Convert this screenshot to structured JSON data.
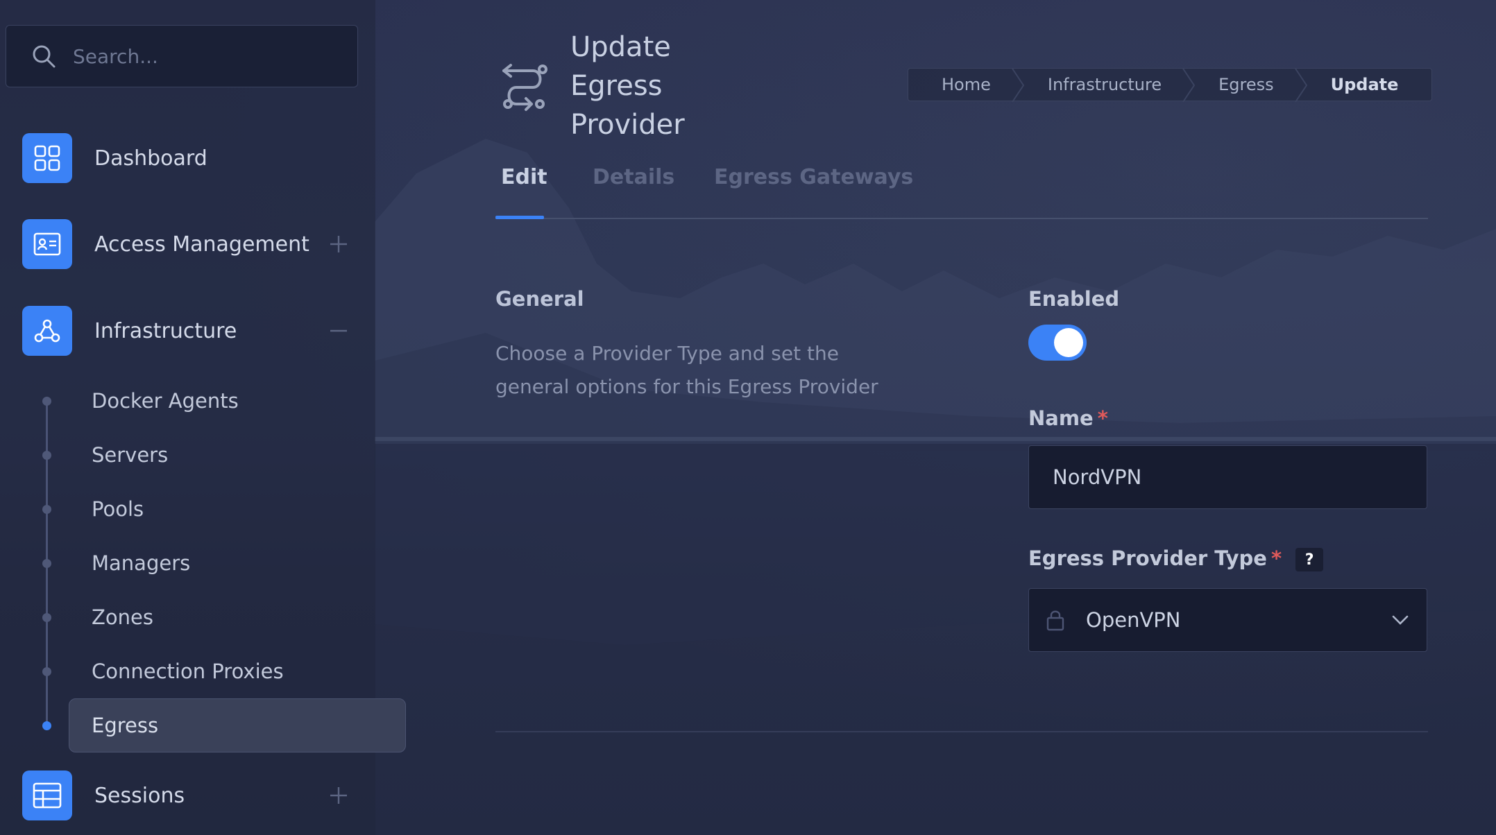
{
  "sidebar": {
    "search_placeholder": "Search...",
    "items": [
      {
        "label": "Dashboard"
      },
      {
        "label": "Access Management"
      },
      {
        "label": "Infrastructure"
      },
      {
        "label": "Sessions"
      }
    ],
    "infrastructure_children": [
      {
        "label": "Docker Agents"
      },
      {
        "label": "Servers"
      },
      {
        "label": "Pools"
      },
      {
        "label": "Managers"
      },
      {
        "label": "Zones"
      },
      {
        "label": "Connection Proxies"
      },
      {
        "label": "Egress",
        "active": true
      }
    ]
  },
  "header": {
    "title": "Update Egress Provider",
    "breadcrumb": [
      "Home",
      "Infrastructure",
      "Egress",
      "Update"
    ]
  },
  "tabs": [
    "Edit",
    "Details",
    "Egress Gateways"
  ],
  "form": {
    "general_title": "General",
    "general_description": "Choose a Provider Type and set the general options for this Egress Provider",
    "enabled_label": "Enabled",
    "enabled": true,
    "name_label": "Name",
    "name_value": "NordVPN",
    "required_mark": "*",
    "type_label": "Egress Provider Type",
    "type_help": "?",
    "type_value": "OpenVPN"
  },
  "colors": {
    "accent": "#3b82f6",
    "required": "#e05a5a"
  }
}
